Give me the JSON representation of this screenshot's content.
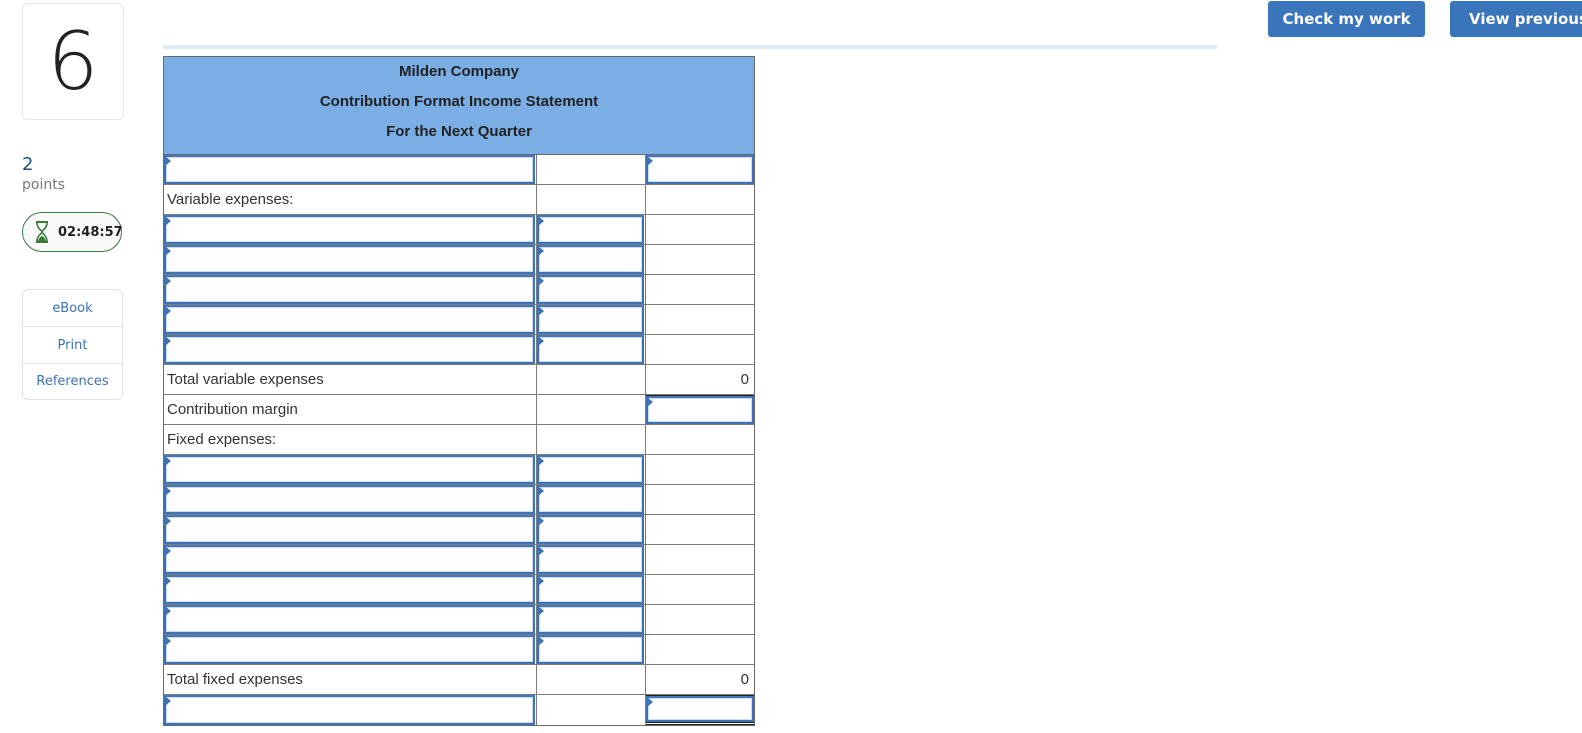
{
  "question": {
    "number": "6",
    "points_value": "2",
    "points_label": "points",
    "timer": "02:48:57"
  },
  "tools": [
    {
      "label": "eBook"
    },
    {
      "label": "Print"
    },
    {
      "label": "References"
    }
  ],
  "buttons": {
    "check_my_work": "Check my work",
    "view_previous": "View previous"
  },
  "statement": {
    "company": "Milden Company",
    "title": "Contribution Format Income Statement",
    "period": "For the Next Quarter",
    "rows": {
      "sales_line": {
        "c1": "",
        "c3": ""
      },
      "variable_expenses_label": "Variable expenses:",
      "variable_lines": [
        {
          "c1": "",
          "c2": ""
        },
        {
          "c1": "",
          "c2": ""
        },
        {
          "c1": "",
          "c2": ""
        },
        {
          "c1": "",
          "c2": ""
        },
        {
          "c1": "",
          "c2": ""
        }
      ],
      "total_variable_label": "Total variable expenses",
      "total_variable_value": "0",
      "contribution_margin_label": "Contribution margin",
      "contribution_margin_value": "",
      "fixed_expenses_label": "Fixed expenses:",
      "fixed_lines": [
        {
          "c1": "",
          "c2": ""
        },
        {
          "c1": "",
          "c2": ""
        },
        {
          "c1": "",
          "c2": ""
        },
        {
          "c1": "",
          "c2": ""
        },
        {
          "c1": "",
          "c2": ""
        },
        {
          "c1": "",
          "c2": ""
        },
        {
          "c1": "",
          "c2": ""
        }
      ],
      "total_fixed_label": "Total fixed expenses",
      "total_fixed_value": "0",
      "net_line": {
        "c1": "",
        "c3": ""
      }
    }
  },
  "colors": {
    "header_bg": "#7aaee4",
    "button_bg": "#3a75bb",
    "timer_border": "#3b7a3b",
    "link": "#3a72b8",
    "input_border": "#3e72b5"
  }
}
